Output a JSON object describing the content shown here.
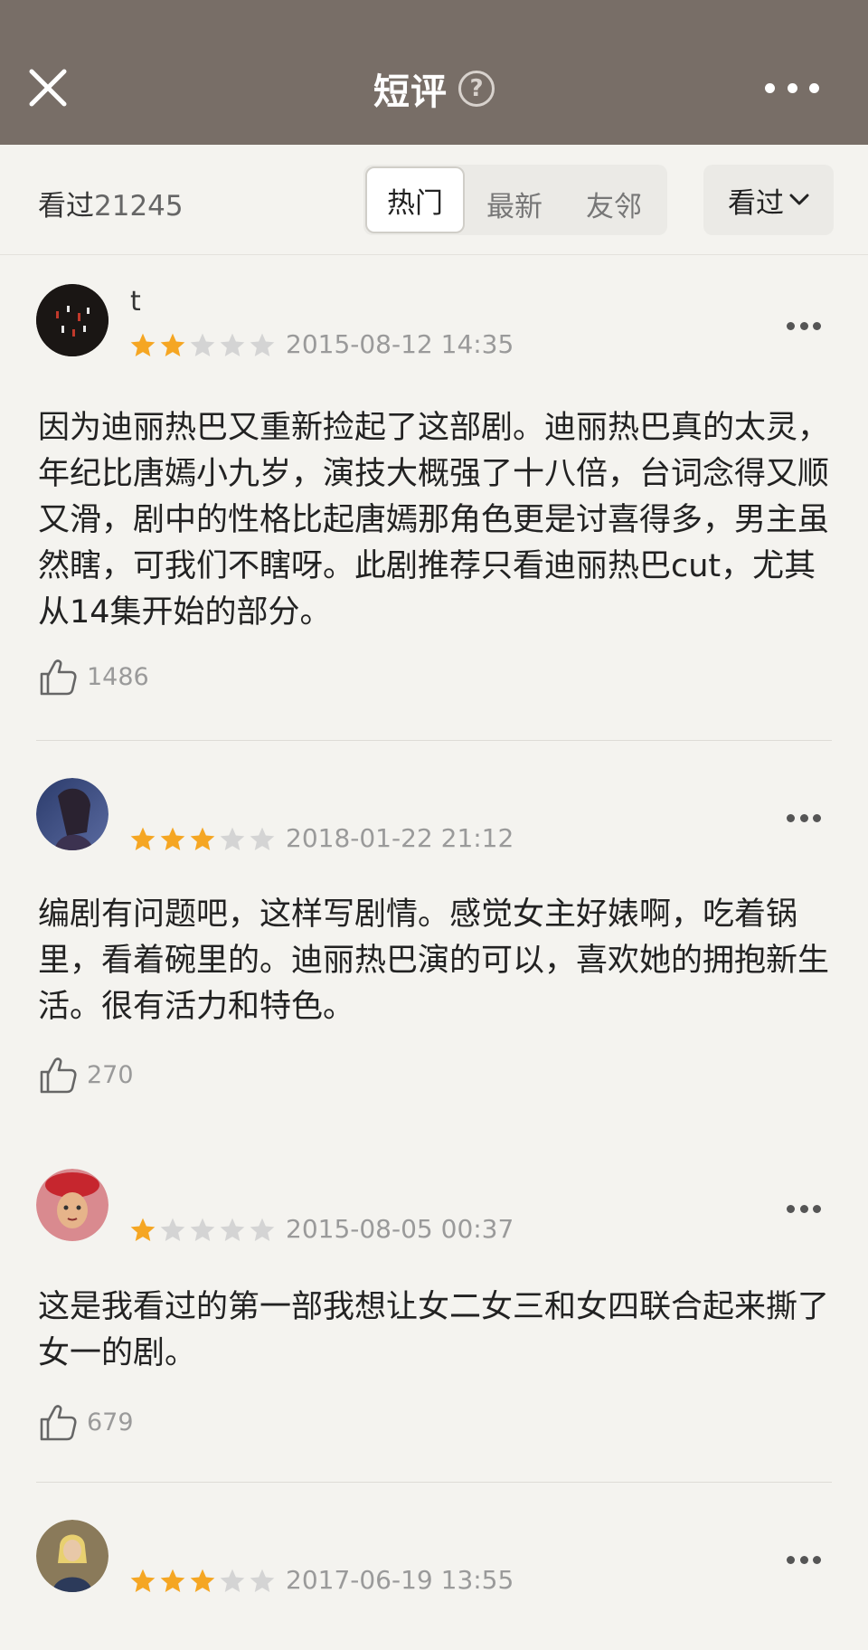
{
  "header": {
    "title": "短评",
    "help_icon": "?",
    "close_icon": "close-icon",
    "more_icon": "more-icon",
    "background": "#786e67"
  },
  "filters": {
    "seen_label": "看过",
    "seen_count": "21245",
    "tabs": [
      "热门",
      "最新",
      "友邻"
    ],
    "active_tab": "热门",
    "sort_label": "看过"
  },
  "reviews": [
    {
      "username": "t",
      "rating": 2,
      "date": "2015-08-12 14:35",
      "text": "因为迪丽热巴又重新捡起了这部剧。迪丽热巴真的太灵，年纪比唐嫣小九岁，演技大概强了十八倍，台词念得又顺又滑，剧中的性格比起唐嫣那角色更是讨喜得多，男主虽然瞎，可我们不瞎呀。此剧推荐只看迪丽热巴cut，尤其从14集开始的部分。",
      "likes": "1486"
    },
    {
      "username": "",
      "rating": 3,
      "date": "2018-01-22 21:12",
      "text": "编剧有问题吧，这样写剧情。感觉女主好婊啊，吃着锅里，看着碗里的。迪丽热巴演的可以，喜欢她的拥抱新生活。很有活力和特色。",
      "likes": "270"
    },
    {
      "username": "",
      "rating": 1,
      "date": "2015-08-05 00:37",
      "text": "这是我看过的第一部我想让女二女三和女四联合起来撕了女一的剧。",
      "likes": "679"
    },
    {
      "username": "",
      "rating": 3,
      "date": "2017-06-19 13:55",
      "text": "",
      "likes": ""
    }
  ],
  "colors": {
    "star_filled": "#f5a623",
    "star_empty": "#d4d4d4",
    "page_bg": "#f4f3ef"
  }
}
